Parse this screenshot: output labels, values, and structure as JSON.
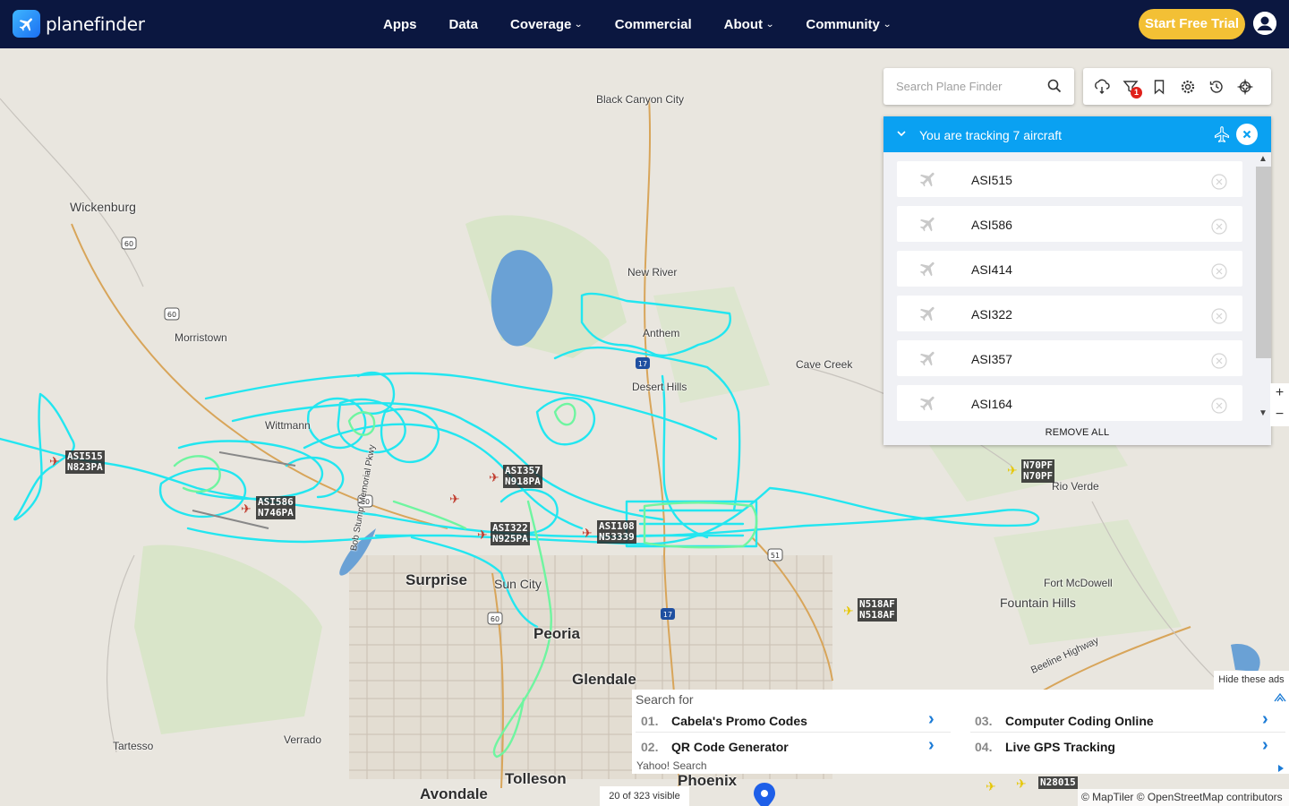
{
  "app": {
    "logo_text": "planefinder",
    "nav": [
      {
        "label": "Apps",
        "has_dropdown": false
      },
      {
        "label": "Data",
        "has_dropdown": false
      },
      {
        "label": "Coverage",
        "has_dropdown": true
      },
      {
        "label": "Commercial",
        "has_dropdown": false
      },
      {
        "label": "About",
        "has_dropdown": true
      },
      {
        "label": "Community",
        "has_dropdown": true
      }
    ],
    "trial_button": "Start Free Trial",
    "colors": {
      "nav_bg": "#0b1740",
      "trial": "#f3c035",
      "panel_header": "#0aa1f2",
      "track_cyan": "#22e6f0",
      "track_green": "#6ff5a0"
    }
  },
  "search": {
    "placeholder": "Search Plane Finder"
  },
  "toolbar": {
    "icons": [
      "weather-icon",
      "filter-icon",
      "bookmark-icon",
      "settings-icon",
      "history-icon",
      "playback-icon"
    ],
    "filter_badge": "1"
  },
  "tracking": {
    "title": "You are tracking 7 aircraft",
    "aircraft": [
      "ASI515",
      "ASI586",
      "ASI414",
      "ASI322",
      "ASI357",
      "ASI164"
    ],
    "remove_all": "REMOVE ALL"
  },
  "zoom": {
    "in": "+",
    "out": "−"
  },
  "map": {
    "places": [
      {
        "name": "Black Canyon City"
      },
      {
        "name": "Wickenburg"
      },
      {
        "name": "New River"
      },
      {
        "name": "Morristown"
      },
      {
        "name": "Anthem"
      },
      {
        "name": "Cave Creek"
      },
      {
        "name": "Desert Hills"
      },
      {
        "name": "Wittmann"
      },
      {
        "name": "Rio Verde"
      },
      {
        "name": "Surprise"
      },
      {
        "name": "Sun City"
      },
      {
        "name": "Fort McDowell"
      },
      {
        "name": "Fountain Hills"
      },
      {
        "name": "Peoria"
      },
      {
        "name": "Glendale"
      },
      {
        "name": "Tartesso"
      },
      {
        "name": "Verrado"
      },
      {
        "name": "Tolleson"
      },
      {
        "name": "Avondale"
      },
      {
        "name": "Phoenix"
      },
      {
        "name": "Bob Stump Memorial Pkwy"
      },
      {
        "name": "Beeline Highway"
      }
    ],
    "aircraft_labels": [
      {
        "callsign": "ASI515",
        "reg": "N823PA"
      },
      {
        "callsign": "ASI586",
        "reg": "N746PA"
      },
      {
        "callsign": "ASI357",
        "reg": "N918PA"
      },
      {
        "callsign": "ASI322",
        "reg": "N925PA"
      },
      {
        "callsign": "ASI108",
        "reg": "N53339"
      },
      {
        "callsign": "N70PF",
        "reg": "N70PF"
      },
      {
        "callsign": "N518AF",
        "reg": "N518AF"
      },
      {
        "callsign": "N28015",
        "reg": ""
      }
    ],
    "route_shields": [
      "60",
      "60",
      "60",
      "60",
      "17",
      "17",
      "51"
    ]
  },
  "ads": {
    "hide_label": "Hide these ads",
    "search_for": "Search for",
    "items": [
      {
        "num": "01.",
        "text": "Cabela's Promo Codes"
      },
      {
        "num": "02.",
        "text": "QR Code Generator"
      },
      {
        "num": "03.",
        "text": "Computer Coding Online"
      },
      {
        "num": "04.",
        "text": "Live GPS Tracking"
      }
    ],
    "provider": "Yahoo! Search"
  },
  "footer": {
    "visible_count": "20 of 323 visible",
    "attribution": "© MapTiler © OpenStreetMap contributors"
  }
}
